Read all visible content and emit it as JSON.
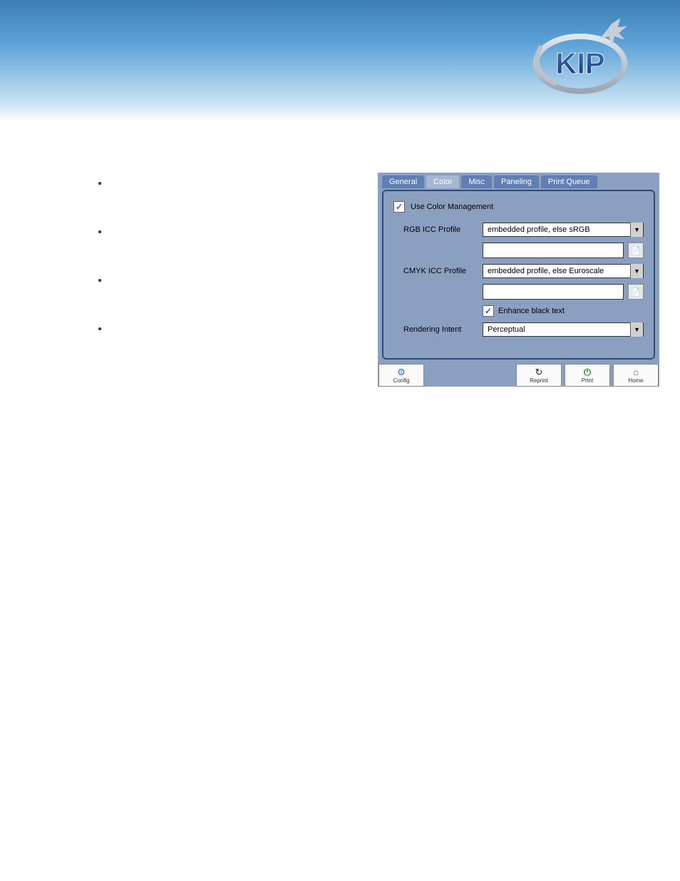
{
  "brand": {
    "name": "KIP"
  },
  "tabs": {
    "general": "General",
    "color": "Color",
    "misc": "Misc",
    "paneling": "Paneling",
    "printqueue": "Print Queue"
  },
  "color_panel": {
    "use_color_mgmt_label": "Use Color Management",
    "use_color_mgmt_checked": true,
    "rgb_label": "RGB ICC Profile",
    "rgb_select_value": "embedded profile, else sRGB",
    "rgb_path_value": "",
    "cmyk_label": "CMYK ICC Profile",
    "cmyk_select_value": "embedded profile, else Euroscale",
    "cmyk_path_value": "",
    "enhance_black_label": "Enhance black text",
    "enhance_black_checked": true,
    "rendering_label": "Rendering Intent",
    "rendering_value": "Perceptual"
  },
  "bottom": {
    "config": "Config",
    "reprint": "Reprint",
    "print": "Print",
    "home": "Home"
  },
  "bullets": [
    "",
    "",
    "",
    ""
  ]
}
